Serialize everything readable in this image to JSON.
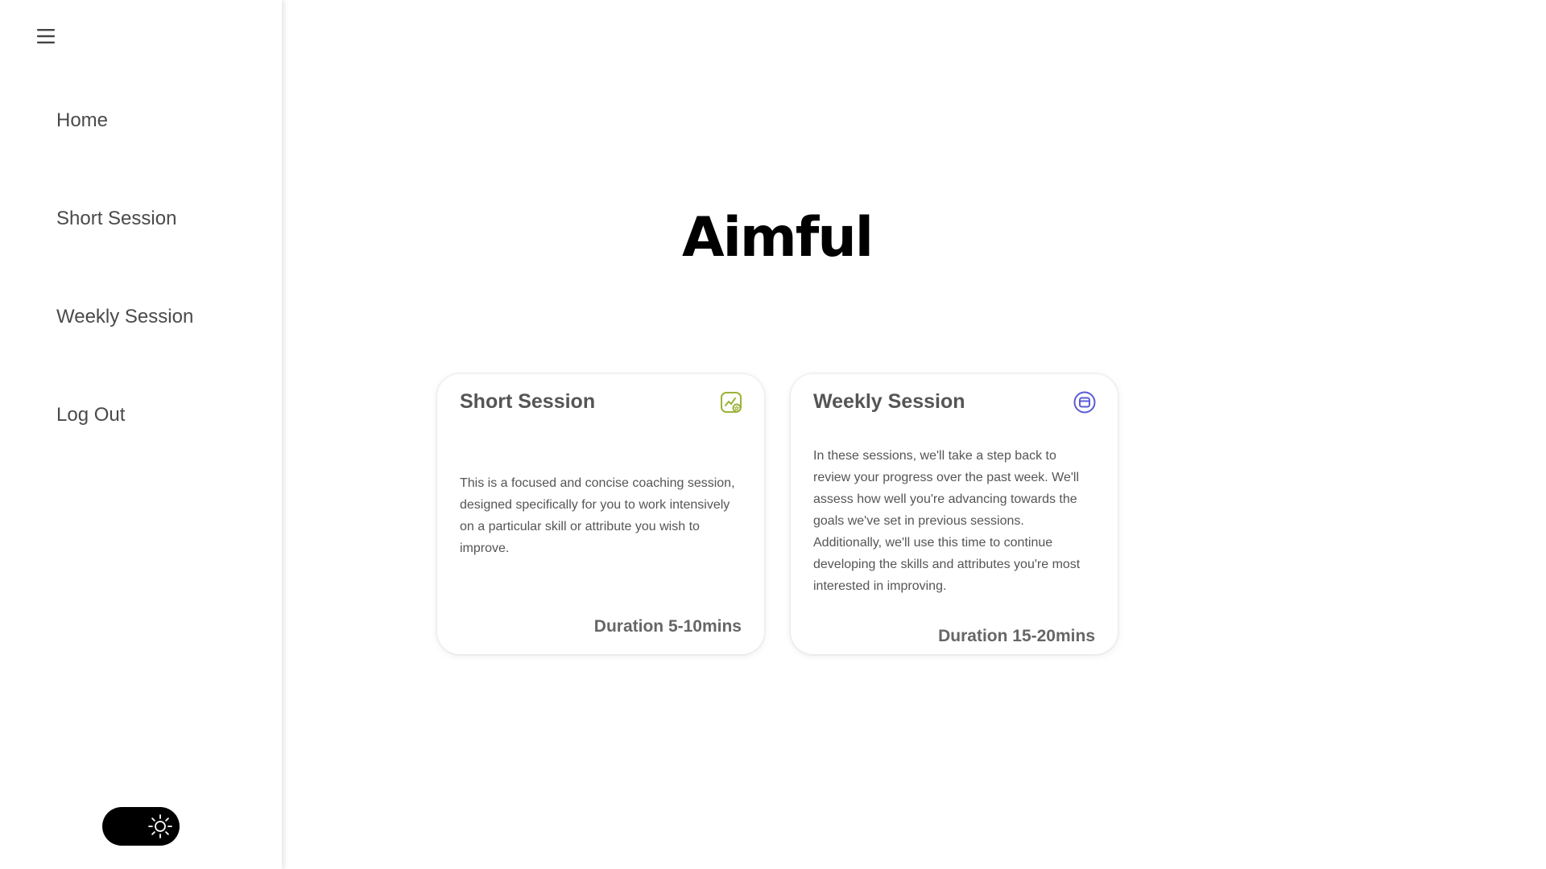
{
  "sidebar": {
    "menu_icon": "hamburger-menu-icon",
    "items": [
      {
        "label": "Home"
      },
      {
        "label": "Short Session"
      },
      {
        "label": "Weekly Session"
      },
      {
        "label": "Log Out"
      }
    ],
    "theme_toggle": {
      "icon": "sun-icon",
      "state": "light"
    }
  },
  "main": {
    "brand": "Aimful",
    "cards": [
      {
        "title": "Short Session",
        "icon": "chart-badge-icon",
        "icon_color": "#9bb33a",
        "description": "This is a focused and concise coaching session, designed specifically for you to work intensively on a particular skill or attribute you wish to improve.",
        "duration": "Duration 5-10mins"
      },
      {
        "title": "Weekly Session",
        "icon": "calendar-circle-icon",
        "icon_color": "#5b5bd6",
        "description": "In these sessions, we'll take a step back to review your progress over the past week. We'll assess how well you're advancing towards the goals we've set in previous sessions. Additionally, we'll use this time to continue developing the skills and attributes you're most interested in improving.",
        "duration": "Duration 15-20mins"
      }
    ]
  },
  "colors": {
    "text": "#4a4a4a",
    "brand": "#000000",
    "toggle_bg": "#000000"
  }
}
